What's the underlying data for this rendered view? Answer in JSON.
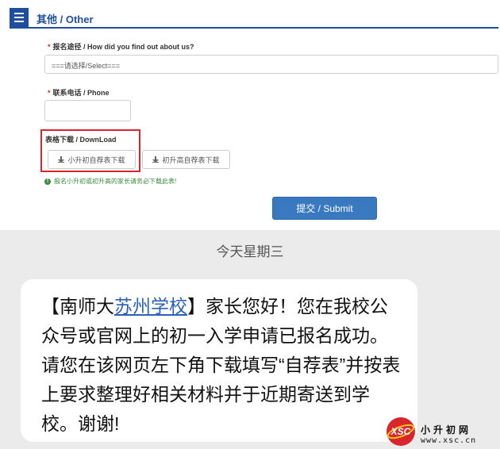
{
  "header": {
    "title": "其他 / Other"
  },
  "form": {
    "source_field": {
      "required_mark": "*",
      "label": "报名途径 /  How did you find out about us?",
      "value": "===请选择/Select==="
    },
    "phone_field": {
      "required_mark": "*",
      "label": "联系电话 / Phone",
      "value": ""
    },
    "download": {
      "label": "表格下载 / DownLoad",
      "button_primary": "小升初自荐表下载",
      "button_secondary": "初升高自荐表下载"
    },
    "notice": "报名小升初或初升高的家长请务必下载此表!",
    "submit_label": "提交 / Submit"
  },
  "chat": {
    "date": "今天星期三",
    "message_prefix": "【南师大",
    "message_link": "苏州学校",
    "message_suffix": "】家长您好！您在我校公众号或官网上的初一入学申请已报名成功。请您在该网页左下角下载填写“自荐表”并按表上要求整理好相关材料并于近期寄送到学校。谢谢!"
  },
  "watermark": {
    "logo_text": "XSC",
    "title": "小升初网",
    "url": "www.xsc.cn",
    "colors": {
      "logo_red": "#d9262c",
      "logo_yellow": "#f2c21b"
    }
  },
  "colors": {
    "brand_blue": "#1e4e9c",
    "button_blue": "#3979bf",
    "highlight_red": "#d9262c",
    "notice_green": "#3c8a3c"
  }
}
